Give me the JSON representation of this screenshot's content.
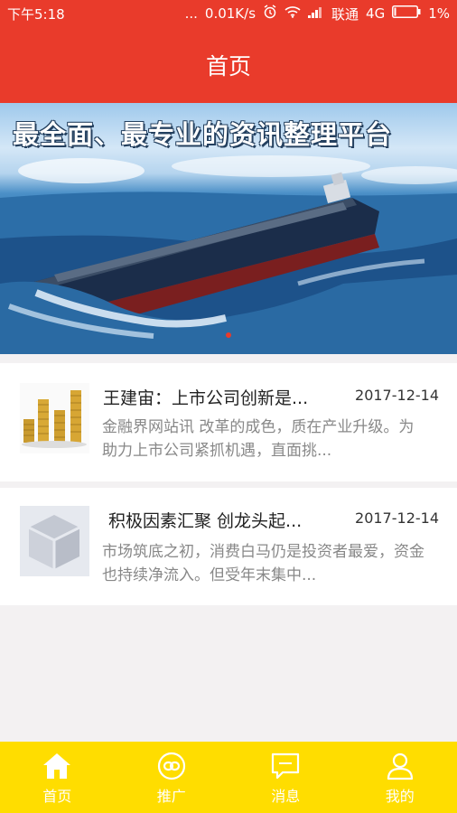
{
  "status": {
    "time": "下午5:18",
    "dots": "...",
    "speed": "0.01K/s",
    "carrier": "联通",
    "network": "4G",
    "battery": "1%"
  },
  "header": {
    "title": "首页"
  },
  "banner": {
    "headline": "最全面、最专业的资讯整理平台"
  },
  "news": [
    {
      "title": "王建宙：上市公司创新是...",
      "date": "2017-12-14",
      "summary": "金融界网站讯 改革的成色，质在产业升级。为助力上市公司紧抓机遇，直面挑...",
      "thumb_icon": "gold-coins-icon"
    },
    {
      "title": "积极因素汇聚 创龙头起...",
      "date": "2017-12-14",
      "summary": "市场筑底之初，消费白马仍是投资者最爱，资金也持续净流入。但受年末集中...",
      "thumb_icon": "placeholder-box-icon"
    }
  ],
  "tabs": [
    {
      "label": "首页",
      "icon": "home-icon"
    },
    {
      "label": "推广",
      "icon": "link-icon"
    },
    {
      "label": "消息",
      "icon": "message-icon"
    },
    {
      "label": "我的",
      "icon": "user-icon"
    }
  ],
  "colors": {
    "primary": "#e93b2b",
    "tabbar": "#ffdd00"
  }
}
